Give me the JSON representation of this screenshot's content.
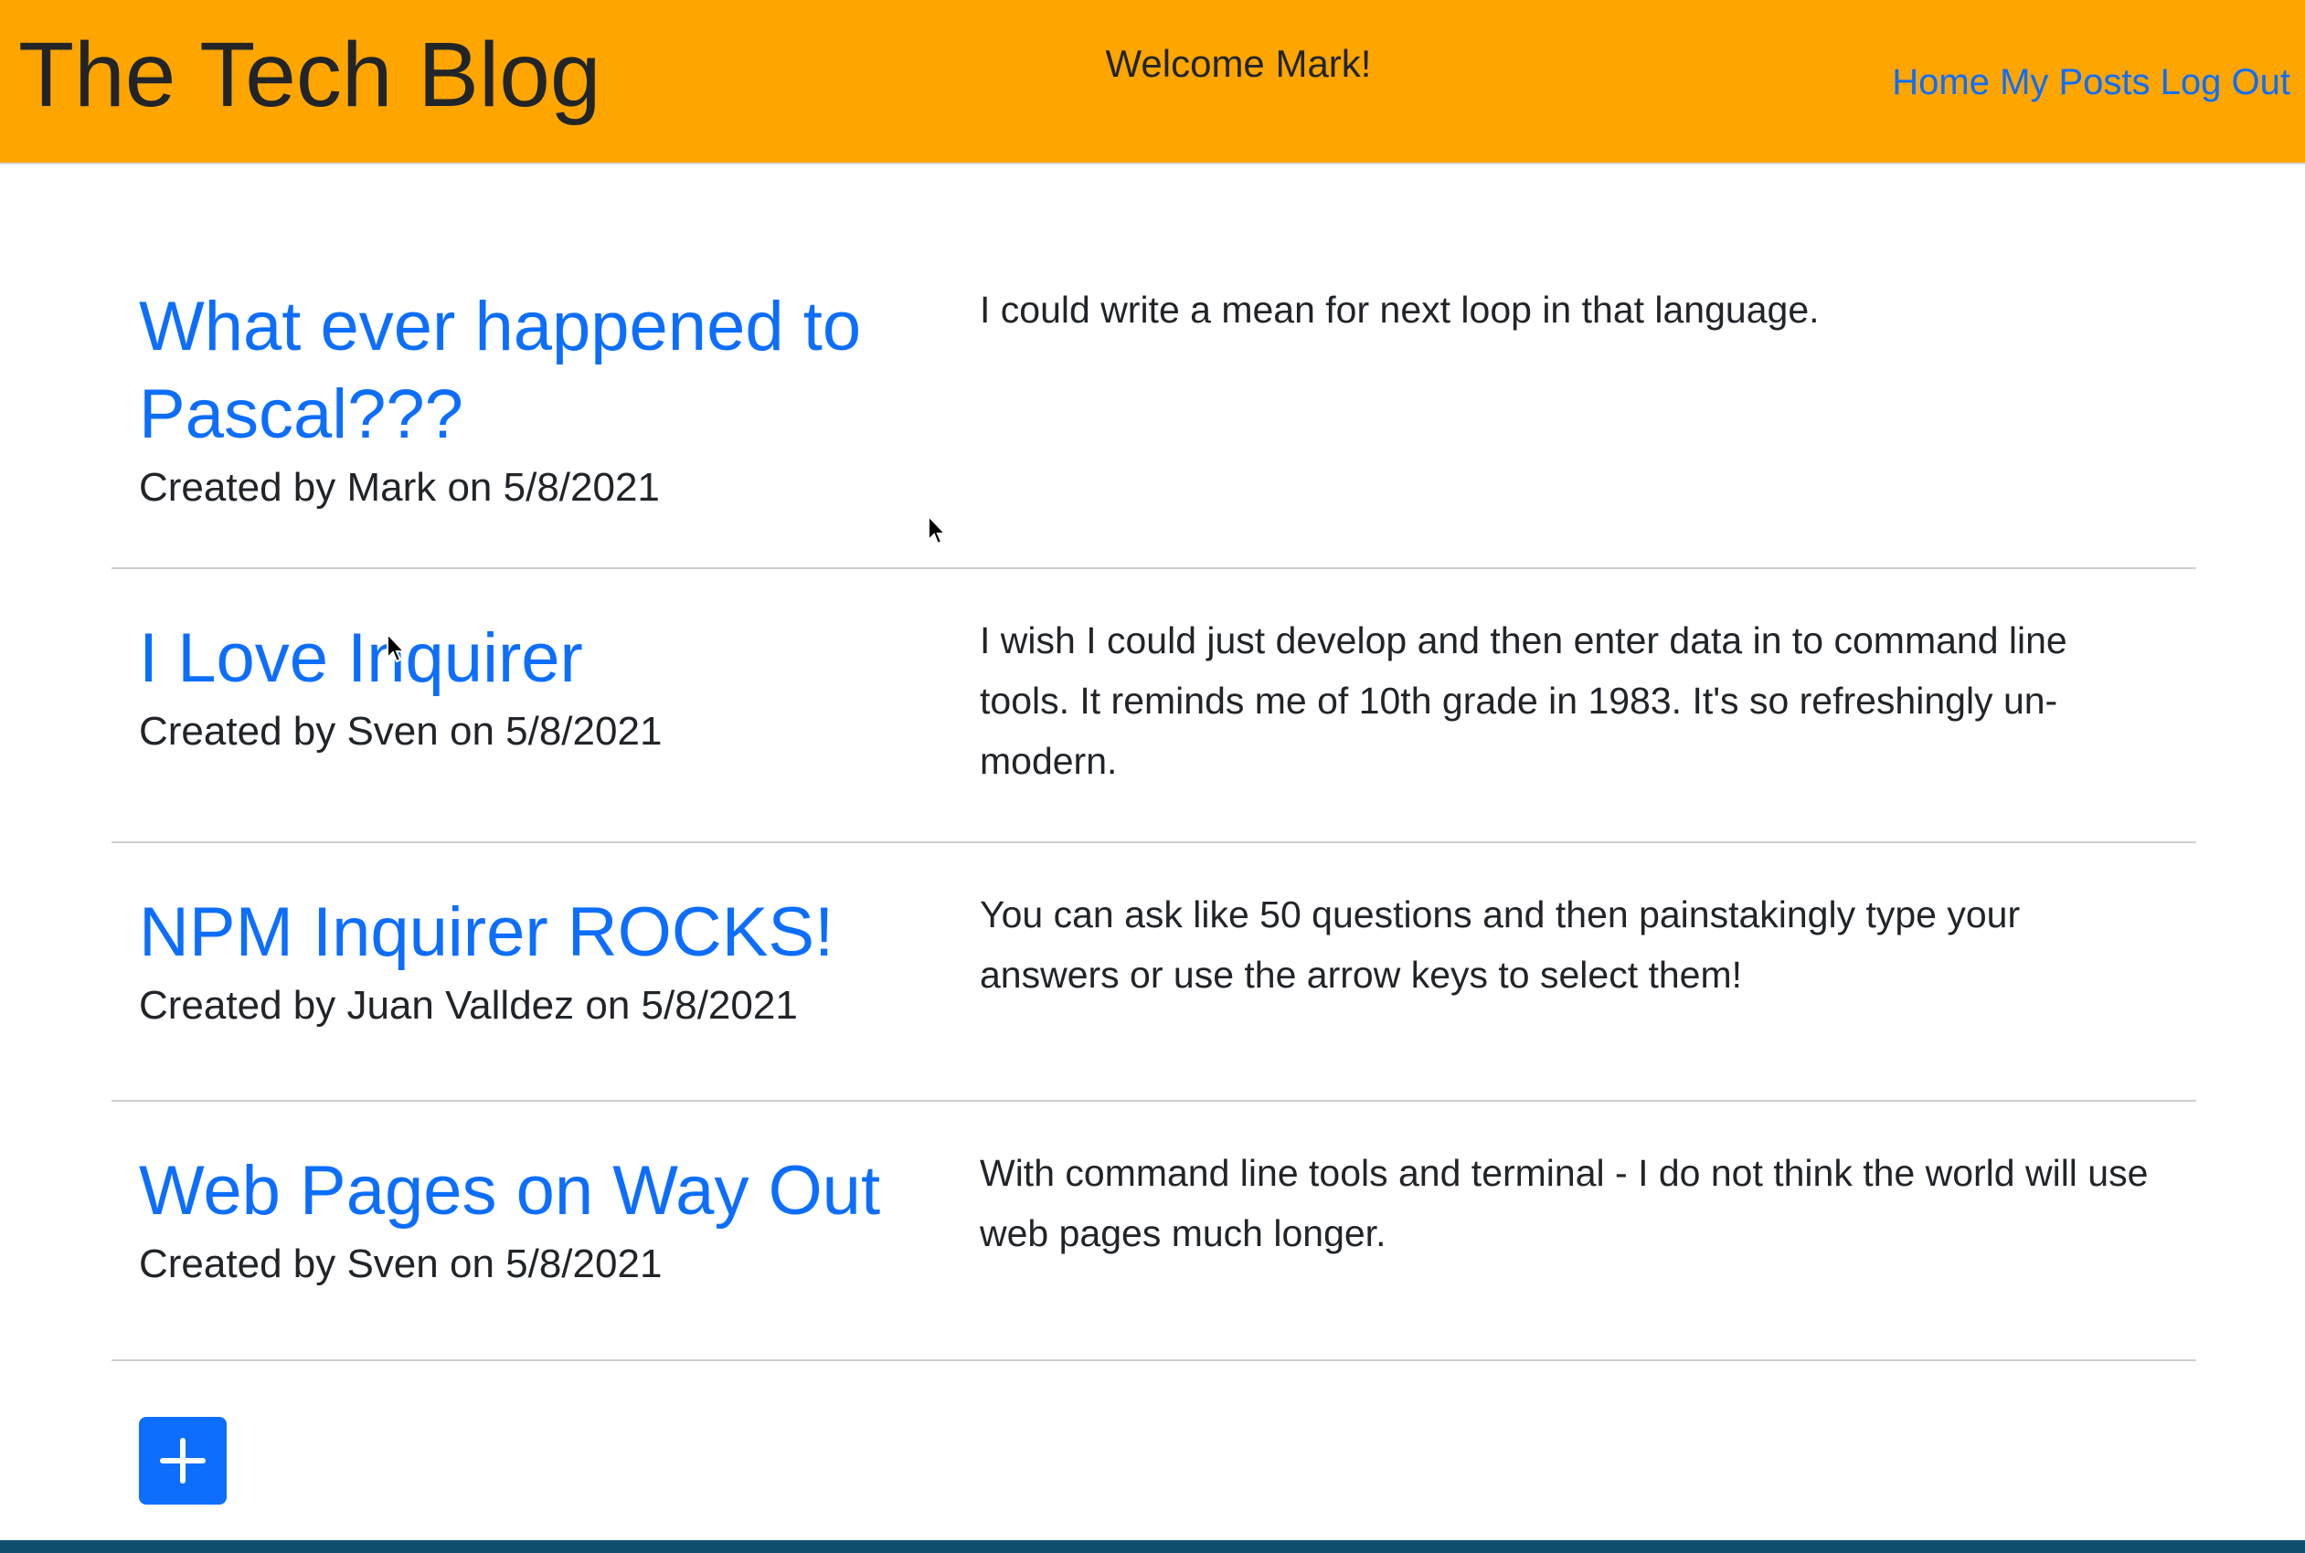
{
  "header": {
    "title": "The Tech Blog",
    "welcome": "Welcome Mark!",
    "nav": [
      {
        "label": "Home"
      },
      {
        "label": "My Posts"
      },
      {
        "label": "Log Out"
      }
    ]
  },
  "posts": [
    {
      "title": "What ever happened to Pascal???",
      "meta": "Created by Mark on 5/8/2021",
      "body": "I could write a mean for next loop in that language."
    },
    {
      "title": "I Love Inquirer",
      "meta": "Created by Sven on 5/8/2021",
      "body": "I wish I could just develop and then enter data in to command line tools. It reminds me of 10th grade in 1983. It's so refreshingly un-modern."
    },
    {
      "title": "NPM Inquirer ROCKS!",
      "meta": "Created by Juan Valldez on 5/8/2021",
      "body": "You can ask like 50 questions and then painstakingly type your answers or use the arrow keys to select them!"
    },
    {
      "title": "Web Pages on Way Out",
      "meta": "Created by Sven on 5/8/2021",
      "body": "With command line tools and terminal - I do not think the world will use web pages much longer."
    }
  ],
  "add_button": {
    "icon": "plus-icon"
  },
  "colors": {
    "header_bg": "#ffa500",
    "link": "#0d6efd",
    "button_bg": "#0d6efd"
  }
}
